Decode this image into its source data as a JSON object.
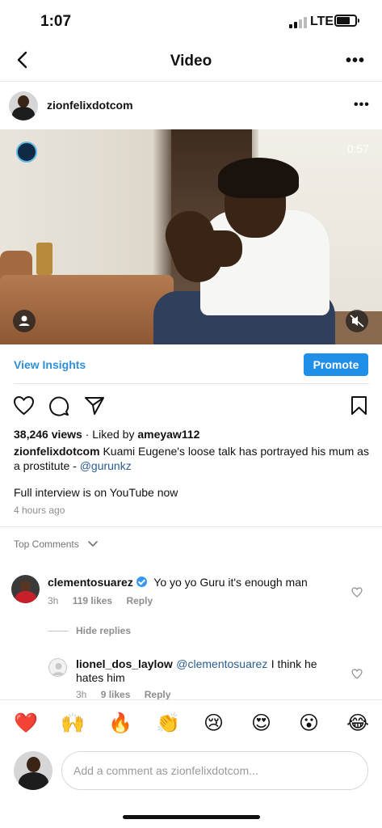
{
  "status_bar": {
    "time": "1:07",
    "network": "LTE"
  },
  "header": {
    "title": "Video",
    "back_icon": "chevron-left-icon",
    "more_label": "•••"
  },
  "post": {
    "username": "zionfelixdotcom",
    "more_label": "•••",
    "video": {
      "duration": "0:57"
    },
    "view_insights": "View Insights",
    "promote": "Promote",
    "views": "38,246 views",
    "liked_by_prefix": "· Liked by ",
    "liked_by_user": "ameyaw112",
    "caption_user": "zionfelixdotcom",
    "caption_text": "Kuami Eugene's loose talk has portrayed his mum as a prostitute - ",
    "caption_mention": "@gurunkz",
    "caption_line2": "Full interview is on YouTube now",
    "time_ago": "4 hours ago"
  },
  "comments": {
    "top_label": "Top Comments",
    "items": [
      {
        "user": "clementosuarez",
        "text": "Yo yo yo Guru it's enough man",
        "time": "3h",
        "likes": "119 likes",
        "reply": "Reply"
      }
    ],
    "hide_replies": "Hide replies",
    "replies": [
      {
        "user": "lionel_dos_laylow",
        "mention": "@clementosuarez",
        "text_part1": "I think he",
        "text_part2": "hates him",
        "time": "3h",
        "likes": "9 likes",
        "reply": "Reply"
      }
    ]
  },
  "emoji_bar": [
    "❤️",
    "🙌",
    "🔥",
    "👏",
    "😢",
    "😍",
    "😮",
    "😂"
  ],
  "composer": {
    "placeholder": "Add a comment as zionfelixdotcom..."
  },
  "colors": {
    "accent": "#1f8fe8",
    "link": "#2f8fd8",
    "mention": "#2b5d8f"
  }
}
